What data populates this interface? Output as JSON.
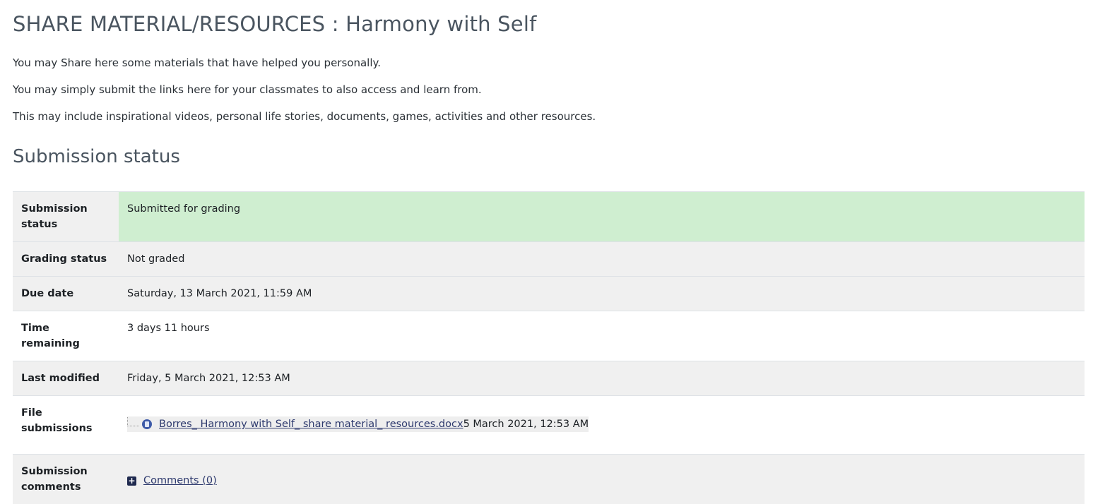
{
  "page_title": "SHARE MATERIAL/RESOURCES : Harmony with Self",
  "intro": {
    "line1": "You may Share here some materials that have helped you personally.",
    "line2": "You may simply submit the links here for your classmates to also access and learn from.",
    "line3": "This may include inspirational videos, personal life stories, documents,  games, activities and other resources."
  },
  "section_title": "Submission status",
  "status_table": {
    "submission_status": {
      "label": "Submission status",
      "value": "Submitted for grading"
    },
    "grading_status": {
      "label": "Grading status",
      "value": "Not graded"
    },
    "due_date": {
      "label": "Due date",
      "value": "Saturday, 13 March 2021, 11:59 AM"
    },
    "time_remaining": {
      "label": "Time remaining",
      "value": "3 days 11 hours"
    },
    "last_modified": {
      "label": "Last modified",
      "value": "Friday, 5 March 2021, 12:53 AM"
    },
    "file_submissions": {
      "label": "File submissions",
      "file_name": "Borres_ Harmony with Self_ share material_ resources.docx",
      "file_date": "5 March 2021, 12:53 AM"
    },
    "submission_comments": {
      "label": "Submission comments",
      "link": "Comments (0)"
    }
  },
  "colors": {
    "submitted_bg": "#cfeed0",
    "stripe_bg": "#f0f0f0",
    "link": "#2e3a6e"
  },
  "icons": {
    "file": "document-icon",
    "expand": "plus-square-icon"
  }
}
